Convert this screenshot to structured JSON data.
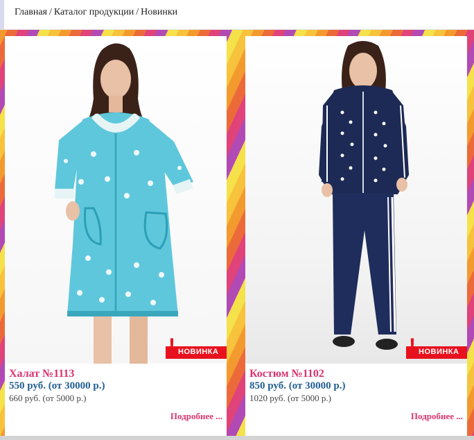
{
  "breadcrumb": {
    "home": "Главная",
    "separator": "/",
    "catalog": "Каталог продукции",
    "current": "Новинки"
  },
  "products": [
    {
      "title": "Халат №1113",
      "price": "550 руб. (от 30000 р.)",
      "retail": "660 руб. (от 5000 р.)",
      "badge": "НОВИНКА",
      "more": "Подробнее ..."
    },
    {
      "title": "Костюм №1102",
      "price": "850 руб. (от 30000 р.)",
      "retail": "1020 руб. (от 5000 р.)",
      "badge": "НОВИНКА",
      "more": "Подробнее ..."
    }
  ],
  "colors": {
    "title_pink": "#d9336e",
    "price_blue": "#1f5d93",
    "badge_red": "#e8121e"
  }
}
